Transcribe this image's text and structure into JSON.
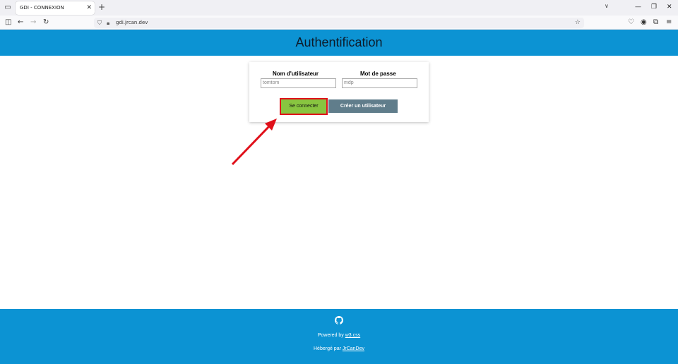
{
  "browser": {
    "tab_title": "GDI - CONNEXION",
    "tab_close": "✕",
    "new_tab": "+",
    "url": "gdi.jrcan.dev"
  },
  "page": {
    "title": "Authentification"
  },
  "form": {
    "username_label": "Nom d'utilisateur",
    "username_value": "tomtom",
    "password_label": "Mot de passe",
    "password_value": "mdp",
    "connect_button": "Se connecter",
    "create_button": "Créer un utilisateur"
  },
  "footer": {
    "powered_prefix": "Powered by ",
    "powered_link": "w3.css",
    "hosted_prefix": "Hébergé par ",
    "hosted_link": "JrCanDev"
  },
  "colors": {
    "header_bg": "#0c93d3",
    "connect_bg": "#88c540",
    "highlight": "#e0101a",
    "create_bg": "#607d8b"
  },
  "icons": [
    "tab-list-icon",
    "close-icon",
    "plus-icon",
    "chevron-down-icon",
    "minimize-icon",
    "restore-icon",
    "sidebar-icon",
    "back-icon",
    "forward-icon",
    "reload-icon",
    "shield-icon",
    "lock-icon",
    "star-icon",
    "pocket-icon",
    "account-icon",
    "extensions-icon",
    "menu-icon",
    "github-icon",
    "arrow-annotation"
  ]
}
